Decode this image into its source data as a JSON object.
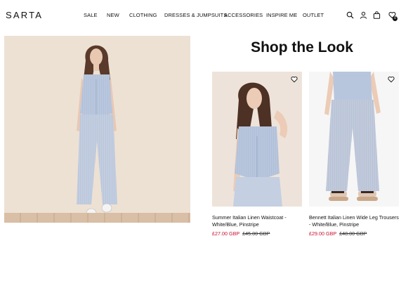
{
  "brand": {
    "logo": "SARTA"
  },
  "nav": {
    "items": [
      {
        "label": "SALE"
      },
      {
        "label": "NEW"
      },
      {
        "label": "CLOTHING"
      },
      {
        "label": "DRESSES & JUMPSUITS"
      },
      {
        "label": "ACCESSORIES"
      },
      {
        "label": "INSPIRE ME"
      },
      {
        "label": "OUTLET"
      }
    ]
  },
  "header_icons": {
    "search": "search-icon",
    "account": "account-icon",
    "bag": "bag-icon",
    "wishlist": "heart-icon",
    "wishlist_count": "0"
  },
  "section": {
    "title": "Shop the Look"
  },
  "products": [
    {
      "name": "Summer Italian Linen Waistcoat - White/Blue, Pinstripe",
      "price": "£27.00 GBP",
      "was_price": "£45.00 GBP"
    },
    {
      "name": "Bennett Italian Linen Wide Leg Trousers - White/Blue, Pinstripe",
      "price": "£29.00 GBP",
      "was_price": "£48.00 GBP"
    }
  ],
  "colors": {
    "sale_price": "#c8102e",
    "text": "#111111",
    "hero_bg": "#ede1d4"
  }
}
